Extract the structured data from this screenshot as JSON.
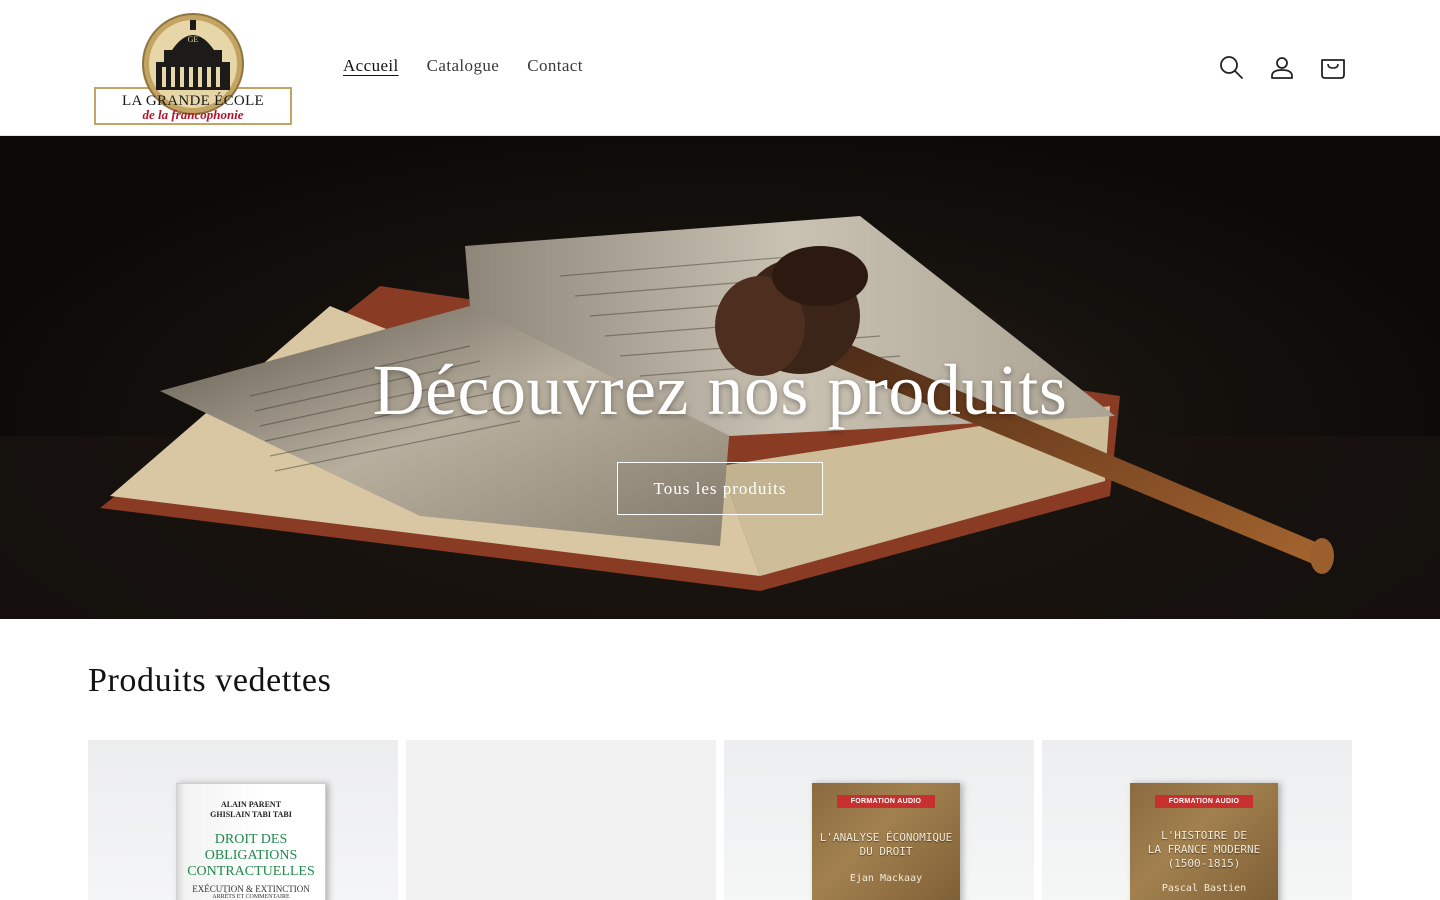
{
  "header": {
    "logo": {
      "line1": "LA GRANDE ÉCOLE",
      "line2": "de la francophonie",
      "emblem_letters": "GE"
    },
    "nav": [
      {
        "label": "Accueil",
        "active": true
      },
      {
        "label": "Catalogue",
        "active": false
      },
      {
        "label": "Contact",
        "active": false
      }
    ],
    "icons": [
      "search-icon",
      "account-icon",
      "cart-icon"
    ]
  },
  "hero": {
    "title": "Découvrez nos produits",
    "button_label": "Tous les produits"
  },
  "featured": {
    "title": "Produits vedettes",
    "products": [
      {
        "authors": [
          "ALAIN PARENT",
          "GHISLAIN TABI TABI"
        ],
        "title_lines": [
          "DROIT DES",
          "OBLIGATIONS",
          "CONTRACTUELLES"
        ],
        "subtitle": "EXÉCUTION & EXTINCTION",
        "subtitle2": "ARRÊTS ET COMMENTAIRE"
      },
      {
        "empty": true
      },
      {
        "badge": "FORMATION AUDIO",
        "title_lines": [
          "L'ANALYSE ÉCONOMIQUE",
          "DU DROIT"
        ],
        "author": "Ejan Mackaay"
      },
      {
        "badge": "FORMATION AUDIO",
        "title_lines": [
          "L'HISTOIRE DE",
          "LA FRANCE MODERNE",
          "(1500-1815)"
        ],
        "author": "Pascal Bastien"
      }
    ]
  },
  "colors": {
    "logo_gold": "#c4a463",
    "logo_red": "#b3122b",
    "badge_red": "#c8302f",
    "title_green": "#1f8a4a"
  }
}
